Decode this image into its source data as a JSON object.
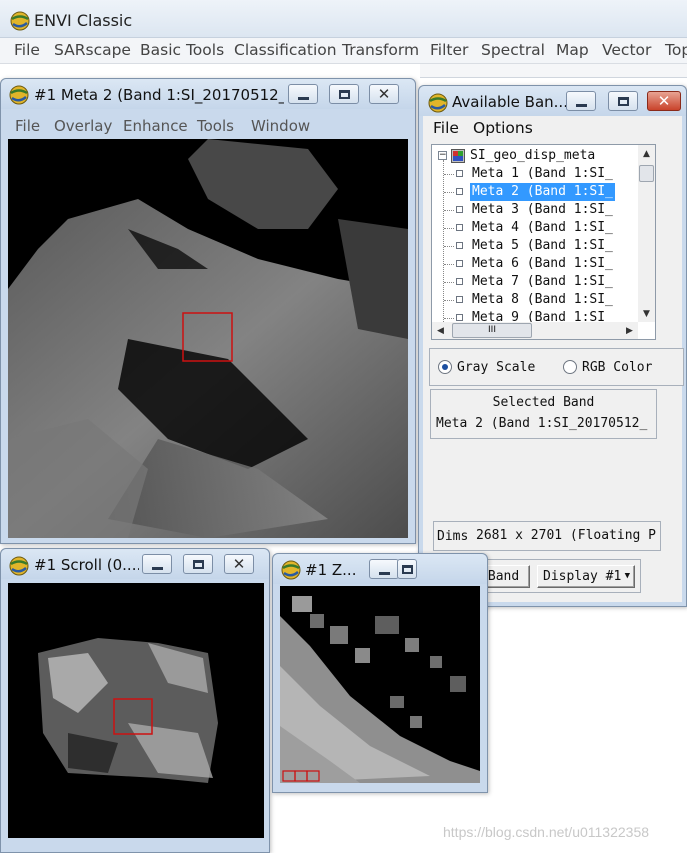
{
  "main": {
    "title": "ENVI Classic",
    "menu": [
      "File",
      "SARscape",
      "Basic Tools",
      "Classification",
      "Transform",
      "Filter",
      "Spectral",
      "Map",
      "Vector",
      "Top"
    ]
  },
  "image_window": {
    "title": "#1 Meta 2 (Band 1:SI_20170512_...",
    "menu": [
      "File",
      "Overlay",
      "Enhance",
      "Tools",
      "Window"
    ]
  },
  "scroll_window": {
    "title": "#1 Scroll (0...."
  },
  "zoom_window": {
    "title": "#1 Z..."
  },
  "bands_window": {
    "title": "Available Ban...",
    "menu": [
      "File",
      "Options"
    ],
    "tree_root": "SI_geo_disp_meta",
    "bands": [
      "Meta 1 (Band 1:SI_",
      "Meta 2 (Band 1:SI_",
      "Meta 3 (Band 1:SI_",
      "Meta 4 (Band 1:SI_",
      "Meta 5 (Band 1:SI_",
      "Meta 6 (Band 1:SI_",
      "Meta 7 (Band 1:SI_",
      "Meta 8 (Band 1:SI_",
      "Meta 9 (Band 1:SI_"
    ],
    "selected_index": 1,
    "scroll_h_glyph": "III",
    "gray_scale_label": "Gray Scale",
    "rgb_color_label": "RGB Color",
    "mode": "gray",
    "selected_band_label": "Selected Band",
    "selected_band_value": "Meta 2 (Band 1:SI_20170512_",
    "dims_label": "Dims",
    "dims_value": "2681 x 2701 (Floating P",
    "load_band_label": "Load Band",
    "display_label": "Display #1"
  },
  "watermark": "https://blog.csdn.net/u011322358",
  "colors": {
    "selection": "#3399ff",
    "roi_box": "#cc1111",
    "titlebar": "#c9d9ec"
  }
}
